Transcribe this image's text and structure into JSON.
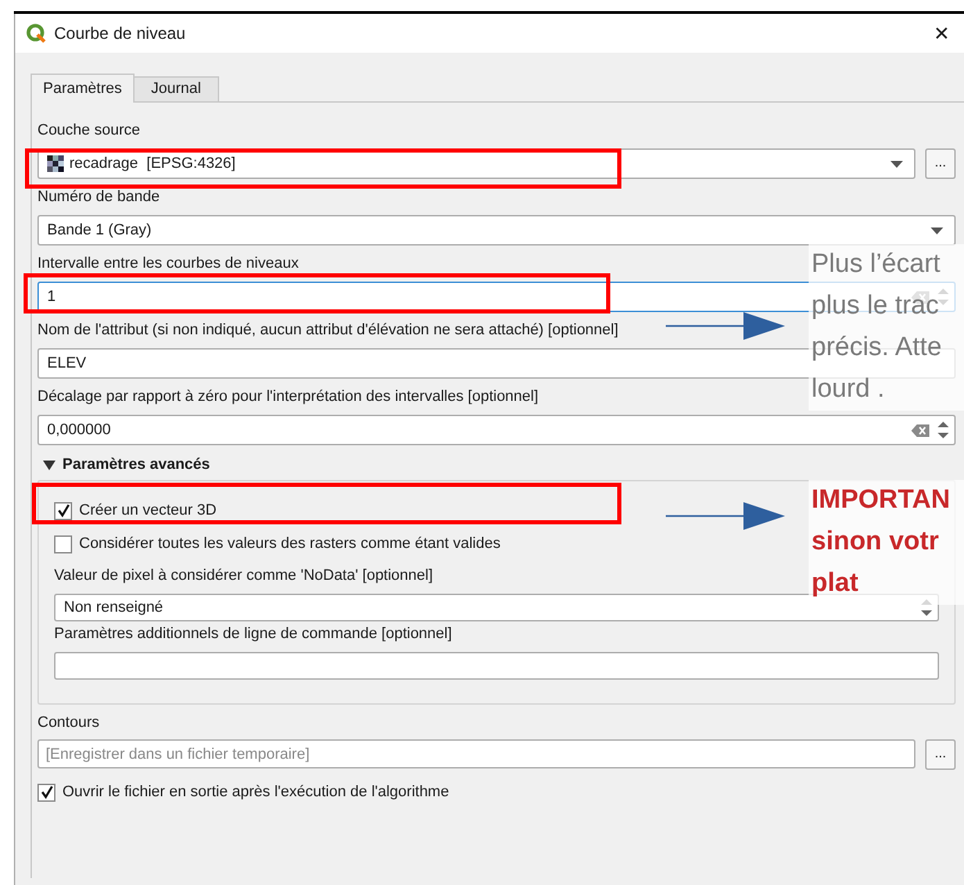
{
  "window": {
    "title": "Courbe de niveau",
    "close": "✕"
  },
  "tabs": [
    {
      "label": "Paramètres",
      "selected": true
    },
    {
      "label": "Journal",
      "selected": false
    }
  ],
  "fields": [
    {
      "kind": "combo",
      "label": "Couche source",
      "value": "recadrage  [EPSG:4326]",
      "layer_icon": true,
      "browse": "..."
    },
    {
      "kind": "combo",
      "label": "Numéro de bande",
      "value": "Bande 1 (Gray)"
    },
    {
      "kind": "spinbox",
      "label": "Intervalle entre les courbes de niveaux",
      "value": "1",
      "focused": true,
      "clearable": true
    },
    {
      "kind": "text",
      "label": "Nom de l'attribut (si non indiqué, aucun attribut d'élévation ne sera attaché) [optionnel]",
      "value": "ELEV"
    },
    {
      "kind": "spinbox",
      "label": "Décalage par rapport à zéro pour l'interprétation des intervalles [optionnel]",
      "value": "0,000000",
      "focused": false,
      "clearable": true
    }
  ],
  "advanced": {
    "title": "Paramètres avancés",
    "expanded": true,
    "items": [
      {
        "kind": "checkbox",
        "label": "Créer un vecteur 3D",
        "checked": true
      },
      {
        "kind": "checkbox",
        "label": "Considérer toutes les valeurs des rasters comme étant valides",
        "checked": false
      },
      {
        "kind": "spinbox",
        "label": "Valeur de pixel à considérer comme 'NoData' [optionnel]",
        "value": "Non renseigné",
        "focused": false,
        "clearable": false
      },
      {
        "kind": "text",
        "label": "Paramètres additionnels de ligne de commande [optionnel]"
      }
    ]
  },
  "output": {
    "label": "Contours",
    "placeholder": "[Enregistrer dans un fichier temporaire]",
    "browse": "..."
  },
  "open_after": {
    "label": "Ouvrir le fichier en sortie après l'exécution de l'algorithme",
    "checked": true
  },
  "annotations": [
    {
      "kind": "note",
      "lines": [
        "Plus l’écart",
        "plus le trac",
        "précis. Atte",
        "lourd ."
      ]
    },
    {
      "kind": "warning",
      "lines": [
        "IMPORTAN",
        "sinon votr",
        "plat"
      ]
    }
  ]
}
